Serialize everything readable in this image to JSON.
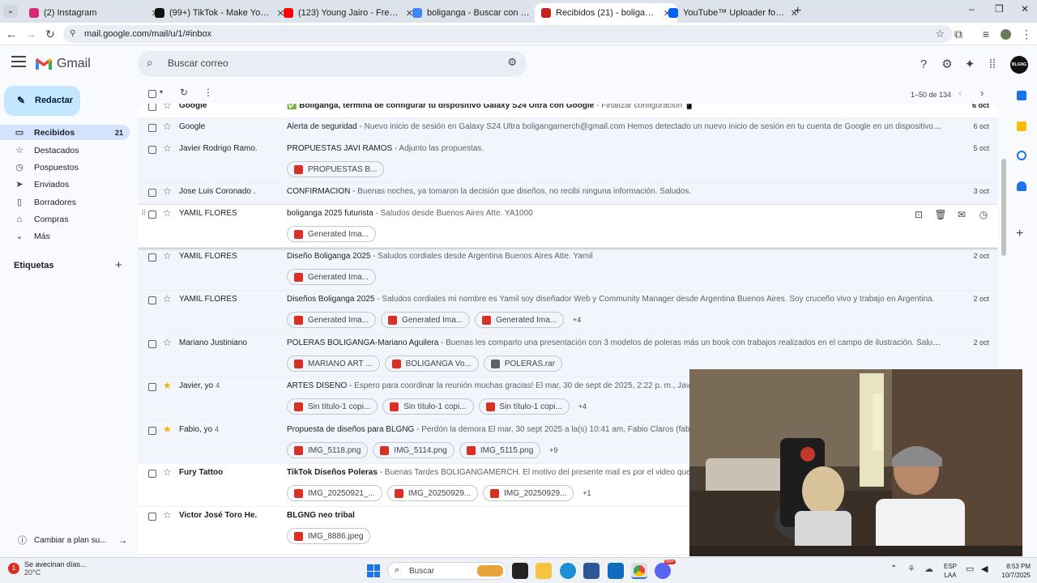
{
  "tabs": [
    {
      "title": "(2) Instagram",
      "color": "#d62976"
    },
    {
      "title": "(99+) TikTok - Make Your Day",
      "color": "#111111"
    },
    {
      "title": "(123) Young Jairo - Freestyle 5 | ...",
      "color": "#ff0000"
    },
    {
      "title": "boliganga - Buscar con Google",
      "color": "#4285f4"
    },
    {
      "title": "Recibidos (21) - boligangamerch",
      "color": "#c5221f"
    },
    {
      "title": "YouTube™ Uploader for Dropbox",
      "color": "#0061fe"
    }
  ],
  "address": "mail.google.com/mail/u/1/#inbox",
  "gmail": {
    "brand": "Gmail",
    "search_placeholder": "Buscar correo",
    "compose": "Redactar",
    "avatar_text": "BLGNG",
    "pagination": "1–50 de 134",
    "nav": [
      {
        "label": "Recibidos",
        "count": "21",
        "icon": "inbox-icon",
        "glyph": "▭"
      },
      {
        "label": "Destacados",
        "icon": "star-icon",
        "glyph": "☆"
      },
      {
        "label": "Pospuestos",
        "icon": "clock-icon",
        "glyph": "◷"
      },
      {
        "label": "Enviados",
        "icon": "send-icon",
        "glyph": "➤"
      },
      {
        "label": "Borradores",
        "icon": "draft-icon",
        "glyph": "▯"
      },
      {
        "label": "Compras",
        "icon": "tag-icon",
        "glyph": "⌂"
      },
      {
        "label": "Más",
        "icon": "chevron-down-icon",
        "glyph": "⌄"
      }
    ],
    "labels_heading": "Etiquetas",
    "plan_link": "Cambiar a plan su..."
  },
  "emails": [
    {
      "sender": "Google",
      "subject": "✅ Boliganga, termina de configurar tu dispositivo Galaxy S24 Ultra con Google",
      "snippet": " - Finalizar configuración 📱",
      "date": "6 oct",
      "bold": true
    },
    {
      "sender": "Google",
      "subject": "Alerta de seguridad",
      "snippet": " - Nuevo inicio de sesión en Galaxy S24 Ultra boligangamerch@gmail.com Hemos detectado un nuevo inicio de sesión en tu cuenta de Google en un dispositivo Galaxy S2",
      "date": "6 oct"
    },
    {
      "sender": "Javier Rodrigo Ramo.",
      "subject": "PROPUESTAS JAVI RAMOS",
      "snippet": " - Adjunto las propuestas.",
      "date": "5 oct",
      "chips": [
        {
          "name": "PROPUESTAS B...",
          "type": "pdf"
        }
      ]
    },
    {
      "sender": "Jose Luis Coronado .",
      "subject": "CONFIRMACION",
      "snippet": " - Buenas noches, ya tomaron la decisión que diseños, no recibi ninguna información. Saludos.",
      "date": "3 oct"
    },
    {
      "sender": "YAMIL FLORES",
      "subject": "boliganga 2025 futurista",
      "snippet": " - Saludos desde Buenos Aires Atte. YA1000",
      "date": "",
      "hover": true,
      "chips": [
        {
          "name": "Generated Ima...",
          "type": "img"
        }
      ]
    },
    {
      "sender": "YAMIL FLORES",
      "subject": "Diseño Boliganga 2025",
      "snippet": " - Saludos cordiales desde Argentina Buenos Aires Atte. Yamil",
      "date": "2 oct",
      "chips": [
        {
          "name": "Generated Ima...",
          "type": "img"
        }
      ]
    },
    {
      "sender": "YAMIL FLORES",
      "subject": "Diseños Boliganga 2025",
      "snippet": " - Saludos cordiales mi nombre es Yamil soy diseñador Web y Community Manager desde Argentina Buenos Aires. Soy cruceño vivo y trabajo en Argentina.",
      "date": "2 oct",
      "chips": [
        {
          "name": "Generated Ima...",
          "type": "img"
        },
        {
          "name": "Generated Ima...",
          "type": "img"
        },
        {
          "name": "Generated Ima...",
          "type": "img"
        }
      ],
      "more": "+4"
    },
    {
      "sender": "Mariano Justiniano",
      "subject": "POLERAS BOLIGANGA-Mariano Aguilera",
      "snippet": " - Buenas les comparto una presentación con 3 modelos de poleras más un book con trabajos realizados en el campo de ilustración. Saludos.",
      "date": "2 oct",
      "chips": [
        {
          "name": "MARIANO ART ...",
          "type": "pdf"
        },
        {
          "name": "BOLIGANGA Vo...",
          "type": "pdf"
        },
        {
          "name": "POLERAS.rar",
          "type": "rar"
        }
      ]
    },
    {
      "sender": "Javier, yo",
      "count": "4",
      "star": true,
      "subject": "ARTES DISEÑO",
      "snippet": " - Espero para coordinar la reunión muchas gracias! El mar, 30 de sept de 2025, 2:22 p. m., Javier Rodri",
      "date": "",
      "chips": [
        {
          "name": "Sin título-1 copi...",
          "type": "img"
        },
        {
          "name": "Sin título-1 copi...",
          "type": "img"
        },
        {
          "name": "Sin título-1 copi...",
          "type": "img"
        }
      ],
      "more": "+4"
    },
    {
      "sender": "Fabio, yo",
      "count": "4",
      "star": true,
      "subject": "Propuesta de diseños para BLGNG",
      "snippet": " - Perdón la demora El mar, 30 sept 2025 a la(s) 10:41 am, Fabio Claros (fabio.claros",
      "date": "",
      "chips": [
        {
          "name": "IMG_5118.png",
          "type": "img"
        },
        {
          "name": "IMG_5114.png",
          "type": "img"
        },
        {
          "name": "IMG_5115.png",
          "type": "img"
        }
      ],
      "more": "+9"
    },
    {
      "sender": "Fury Tattoo",
      "subject": "TikTok Diseños Poleras",
      "snippet": " - Buenas Tardes BOLIGANGAMERCH. El motivo del presente mail es por el video que publica",
      "date": "",
      "bold": true,
      "chips": [
        {
          "name": "IMG_20250921_...",
          "type": "img"
        },
        {
          "name": "IMG_20250929...",
          "type": "img"
        },
        {
          "name": "IMG_20250929...",
          "type": "img"
        }
      ],
      "more": "+1"
    },
    {
      "sender": "Victor José Toro He.",
      "subject": "BLGNG neo tribal",
      "snippet": "",
      "date": "",
      "bold": true,
      "chips": [
        {
          "name": "IMG_8886.jpeg",
          "type": "img"
        }
      ]
    }
  ],
  "taskbar": {
    "weather_text": "Se avecinan días...",
    "weather_temp": "20°C",
    "search": "Buscar",
    "lang1": "ESP",
    "lang2": "LAA",
    "time": "8:53 PM",
    "date": "10/7/2025",
    "notif_badge": "1",
    "app_badge": "99+"
  }
}
